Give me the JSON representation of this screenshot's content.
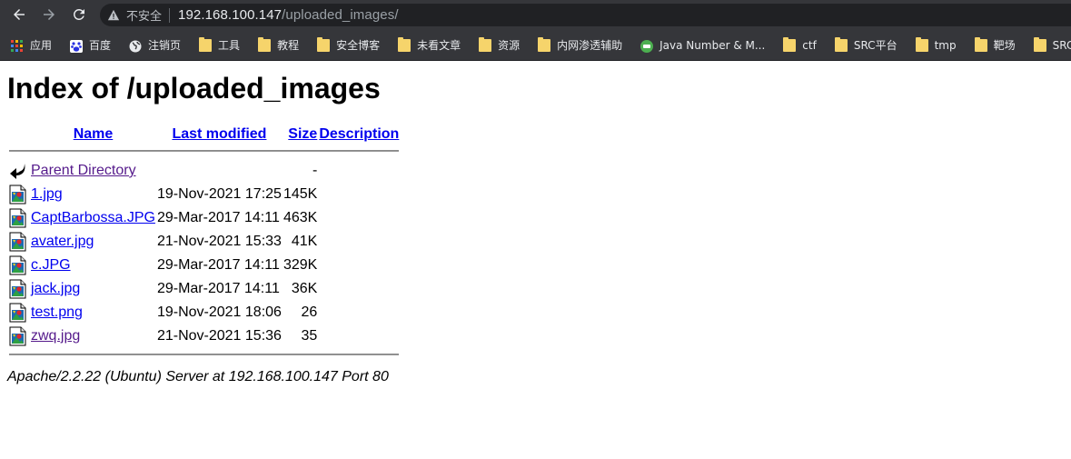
{
  "browser": {
    "security_label": "不安全",
    "url_host": "192.168.100.147",
    "url_path": "/uploaded_images/"
  },
  "bookmarks": [
    {
      "label": "应用",
      "icon": "apps-grid-icon"
    },
    {
      "label": "百度",
      "icon": "baidu-paw-icon"
    },
    {
      "label": "注销页",
      "icon": "globe-icon"
    },
    {
      "label": "工具",
      "icon": "folder-icon"
    },
    {
      "label": "教程",
      "icon": "folder-icon"
    },
    {
      "label": "安全博客",
      "icon": "folder-icon"
    },
    {
      "label": "未看文章",
      "icon": "folder-icon"
    },
    {
      "label": "资源",
      "icon": "folder-icon"
    },
    {
      "label": "内网渗透辅助",
      "icon": "folder-icon"
    },
    {
      "label": "Java Number & M...",
      "icon": "site-favicon-icon"
    },
    {
      "label": "ctf",
      "icon": "folder-icon"
    },
    {
      "label": "SRC平台",
      "icon": "folder-icon"
    },
    {
      "label": "tmp",
      "icon": "folder-icon"
    },
    {
      "label": "靶场",
      "icon": "folder-icon"
    },
    {
      "label": "SRC工",
      "icon": "folder-icon"
    }
  ],
  "page": {
    "title": "Index of /uploaded_images",
    "columns": {
      "name": "Name",
      "modified": "Last modified",
      "size": "Size",
      "description": "Description"
    },
    "parent": {
      "name": "Parent Directory",
      "modified": "",
      "size": "-"
    },
    "rows": [
      {
        "name": "1.jpg",
        "modified": "19-Nov-2021 17:25",
        "size": "145K",
        "visited": false
      },
      {
        "name": "CaptBarbossa.JPG",
        "modified": "29-Mar-2017 14:11",
        "size": "463K",
        "visited": false
      },
      {
        "name": "avater.jpg",
        "modified": "21-Nov-2021 15:33",
        "size": "41K",
        "visited": false
      },
      {
        "name": "c.JPG",
        "modified": "29-Mar-2017 14:11",
        "size": "329K",
        "visited": false
      },
      {
        "name": "jack.jpg",
        "modified": "29-Mar-2017 14:11",
        "size": "36K",
        "visited": false
      },
      {
        "name": "test.png",
        "modified": "19-Nov-2021 18:06",
        "size": "26",
        "visited": false
      },
      {
        "name": "zwq.jpg",
        "modified": "21-Nov-2021 15:36",
        "size": "35",
        "visited": true
      }
    ],
    "footer": "Apache/2.2.22 (Ubuntu) Server at 192.168.100.147 Port 80"
  }
}
